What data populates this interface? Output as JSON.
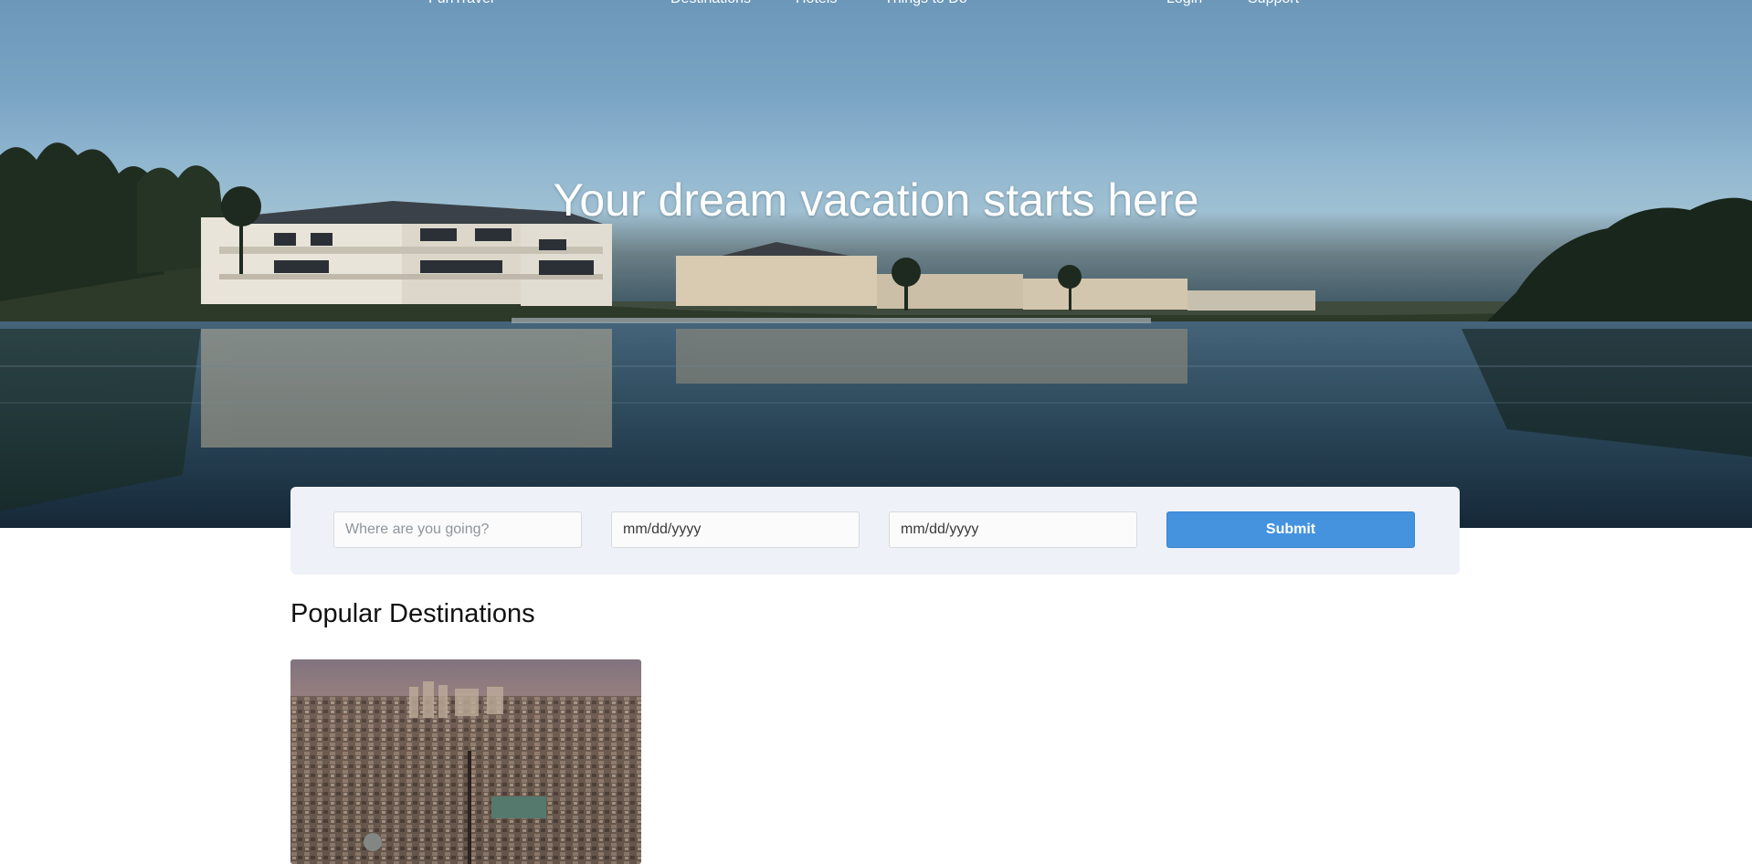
{
  "nav": {
    "brand": "FunTravel",
    "links": [
      "Destinations",
      "Hotels",
      "Things to Do"
    ],
    "login": "Login",
    "support": "Support"
  },
  "hero": {
    "title": "Your dream vacation starts here"
  },
  "search": {
    "destination_placeholder": "Where are you going?",
    "checkin_value": "mm/dd/yyyy",
    "checkout_value": "mm/dd/yyyy",
    "submit_label": "Submit"
  },
  "popular": {
    "title": "Popular Destinations"
  },
  "colors": {
    "accent": "#4592df",
    "panel": "#eef2f8"
  }
}
